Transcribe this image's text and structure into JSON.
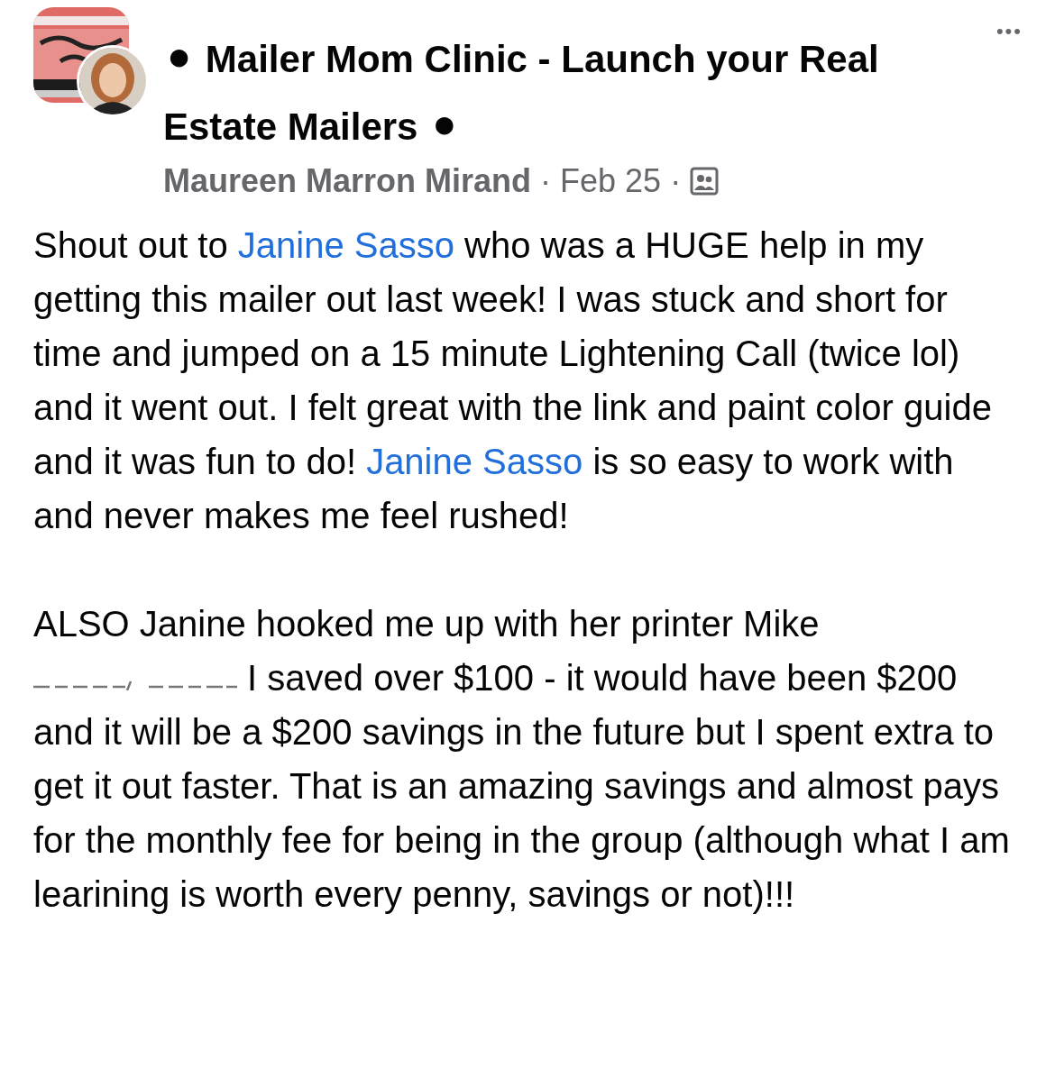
{
  "post": {
    "group_title": "⚫ Mailer Mom Clinic - Launch your Real Estate Mailers ⚫",
    "author": "Maureen Marron Mirand",
    "separator_1": "·",
    "date": "Feb 25",
    "separator_2": "·",
    "more": "•••",
    "paragraphs": [
      [
        {
          "kind": "text",
          "text": "Shout out to "
        },
        {
          "kind": "link",
          "text": "Janine Sasso"
        },
        {
          "kind": "text",
          "text": " who was a HUGE help in my getting this mailer out last week! I was stuck and short for time and jumped on a 15 minute Lightening Call (twice lol) and it went out. I felt great with the link and paint color guide and it was fun to do! "
        },
        {
          "kind": "link",
          "text": "Janine Sasso"
        },
        {
          "kind": "text",
          "text": " is so easy to work with and never makes me feel rushed!"
        }
      ],
      [
        {
          "kind": "text",
          "text": "ALSO Janine hooked me up with her printer Mike "
        },
        {
          "kind": "obscured"
        },
        {
          "kind": "text",
          "text": " I saved over $100 - it would have been $200 and it will be a $200 savings in the future but I spent extra to get it out faster. That is an amazing savings and almost pays for the monthly fee for being in the group (although what I am learining is worth every penny, savings or not)!!!"
        }
      ]
    ]
  }
}
